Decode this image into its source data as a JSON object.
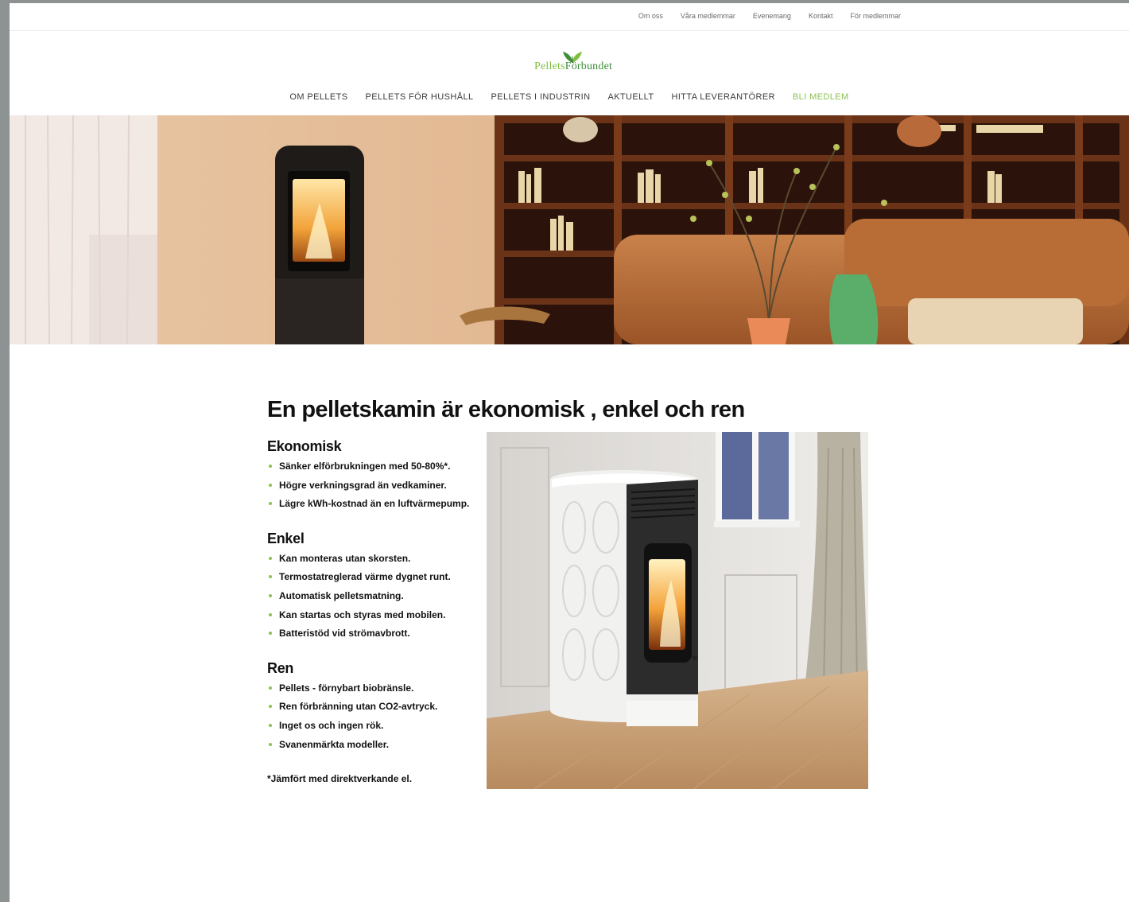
{
  "topbar": {
    "links": [
      "Om oss",
      "Våra medlemmar",
      "Evenemang",
      "Kontakt",
      "För medlemmar"
    ]
  },
  "logo": {
    "word1": "Pellets",
    "word2": "Förbundet"
  },
  "nav": {
    "items": [
      "OM PELLETS",
      "PELLETS FÖR HUSHÅLL",
      "PELLETS I INDUSTRIN",
      "AKTUELLT",
      "HITTA LEVERANTÖRER"
    ],
    "cta": "BLI MEDLEM",
    "accent_color": "#8cc152"
  },
  "main": {
    "title": "En pelletskamin är ekonomisk , enkel och ren",
    "sections": [
      {
        "heading": "Ekonomisk",
        "items": [
          "Sänker elförbrukningen med 50-80%*.",
          "Högre verkningsgrad än vedkaminer.",
          "Lägre kWh-kostnad än en luftvärmepump."
        ]
      },
      {
        "heading": "Enkel",
        "items": [
          "Kan monteras utan skorsten.",
          "Termostatreglerad värme dygnet runt.",
          "Automatisk pelletsmatning.",
          "Kan startas och styras med mobilen.",
          "Batteristöd vid strömavbrott."
        ]
      },
      {
        "heading": "Ren",
        "items": [
          "Pellets - förnybart biobränsle.",
          "Ren förbränning utan CO2-avtryck.",
          "Inget os och ingen rök.",
          "Svanenmärkta modeller."
        ]
      }
    ],
    "footnote": "*Jämfört med direktverkande el."
  }
}
